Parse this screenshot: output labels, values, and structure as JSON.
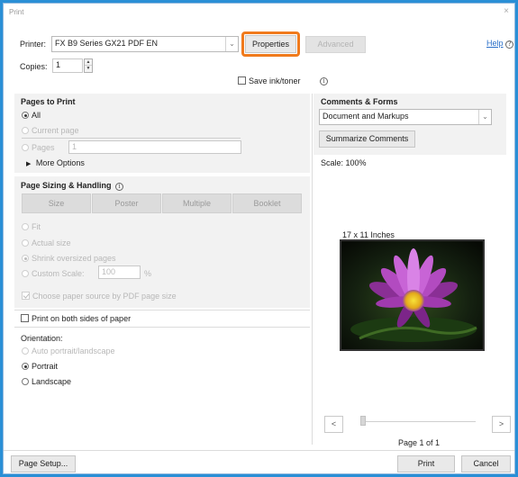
{
  "window": {
    "title": "Print",
    "close": "×"
  },
  "printer": {
    "label": "Printer:",
    "selected": "FX B9 Series GX21 PDF EN",
    "properties_label": "Properties",
    "advanced_label": "Advanced",
    "help_label": "Help"
  },
  "copies": {
    "label": "Copies:",
    "value": "1"
  },
  "save_ink": {
    "label": "Save ink/toner",
    "checked": false
  },
  "pages_to_print": {
    "heading": "Pages to Print",
    "all": "All",
    "current_page": "Current page",
    "pages": "Pages",
    "pages_value": "1",
    "more_options": "More Options"
  },
  "page_sizing": {
    "heading": "Page Sizing & Handling",
    "tabs": [
      "Size",
      "Poster",
      "Multiple",
      "Booklet"
    ],
    "fit": "Fit",
    "actual_size": "Actual size",
    "shrink": "Shrink oversized pages",
    "custom_scale": "Custom Scale:",
    "custom_scale_value": "100",
    "percent": "%",
    "choose_paper": "Choose paper source by PDF page size"
  },
  "duplex": {
    "label": "Print on both sides of paper",
    "checked": false
  },
  "orientation": {
    "heading": "Orientation:",
    "auto": "Auto portrait/landscape",
    "portrait": "Portrait",
    "landscape": "Landscape"
  },
  "comments_forms": {
    "heading": "Comments & Forms",
    "selected": "Document and Markups",
    "summarize": "Summarize Comments"
  },
  "preview": {
    "scale": "Scale: 100%",
    "paper_size": "17 x 11 Inches",
    "page_indicator": "Page 1 of 1"
  },
  "footer": {
    "page_setup": "Page Setup...",
    "print": "Print",
    "cancel": "Cancel"
  },
  "colors": {
    "accent_highlight": "#f07a1c",
    "link": "#2a6fc9",
    "frame": "#2a8fd6"
  }
}
